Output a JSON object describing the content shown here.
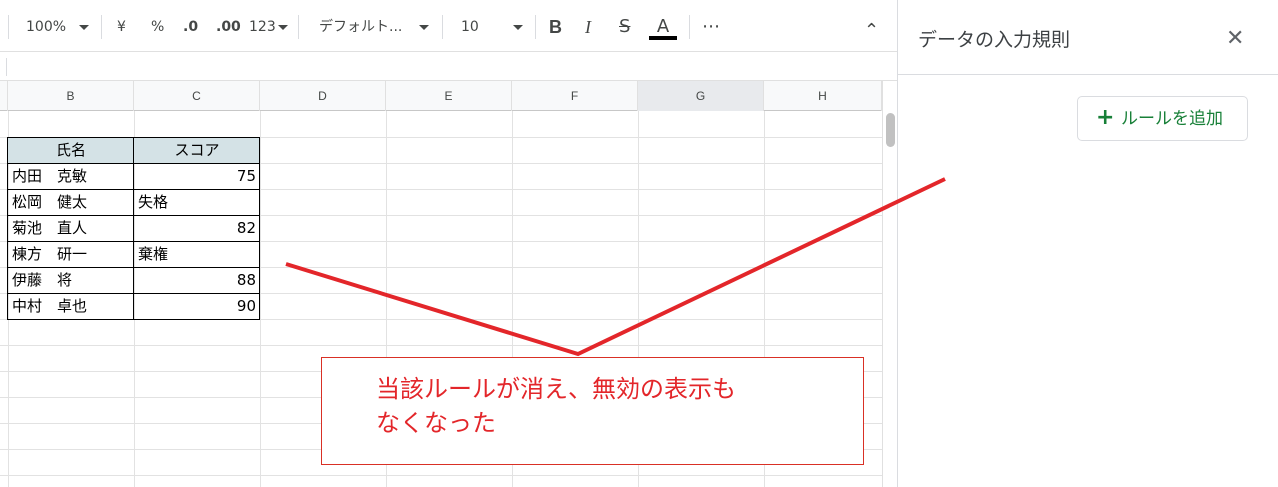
{
  "toolbar": {
    "zoom": "100%",
    "currency": "¥",
    "percent": "%",
    "decrease_decimal": ".0",
    "increase_decimal": ".00",
    "number_format": "123",
    "font": "デフォルト...",
    "font_size": "10",
    "bold": "B",
    "italic": "I",
    "strikethrough": "S",
    "text_color": "A",
    "more": "⋯",
    "collapse": "⌃"
  },
  "columns": [
    "B",
    "C",
    "D",
    "E",
    "F",
    "G",
    "H"
  ],
  "table": {
    "headers": [
      "氏名",
      "スコア"
    ],
    "rows": [
      {
        "name": "内田　克敏",
        "score": "75"
      },
      {
        "name": "松岡　健太",
        "score": "失格"
      },
      {
        "name": "菊池　直人",
        "score": "82"
      },
      {
        "name": "棟方　研一",
        "score": "棄権"
      },
      {
        "name": "伊藤　将",
        "score": "88"
      },
      {
        "name": "中村　卓也",
        "score": "90"
      }
    ]
  },
  "panel": {
    "title": "データの入力規則",
    "close": "✕",
    "add_rule_icon": "+",
    "add_rule_label": "ルールを追加"
  },
  "annotation": {
    "line1": "当該ルールが消え、無効の表示も",
    "line2": "なくなった",
    "color": "#e3262a"
  }
}
